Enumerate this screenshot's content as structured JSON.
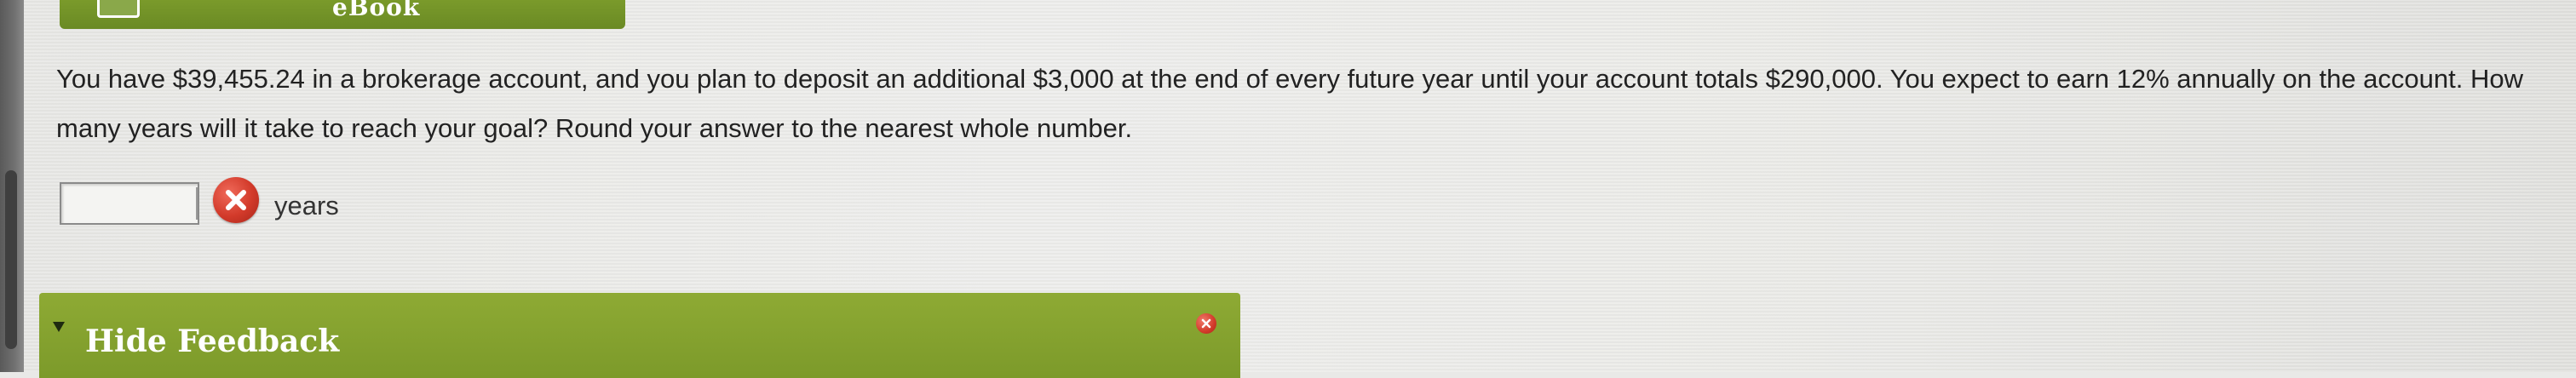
{
  "ebook": {
    "label": "eBook",
    "icon": "book-icon"
  },
  "question": {
    "text": "You have $39,455.24 in a brokerage account, and you plan to deposit an additional $3,000 at the end of every future year until your account totals $290,000. You expect to earn 12% annually on the account. How many years will it take to reach your goal? Round your answer to the nearest whole number."
  },
  "answer": {
    "value": "",
    "unit": "years",
    "status_icon": "incorrect-icon",
    "status_color": "#d23a2a"
  },
  "feedback": {
    "toggle_label": "Hide Feedback",
    "toggle_icon": "triangle-down-icon",
    "close_icon": "close-icon",
    "bar_color": "#7c9a2a"
  }
}
